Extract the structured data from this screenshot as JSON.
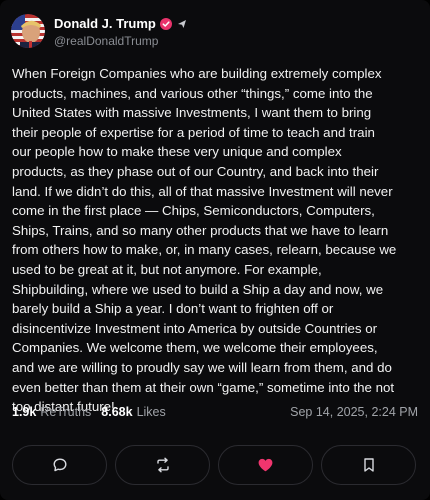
{
  "author": {
    "display_name": "Donald J. Trump",
    "handle": "@realDonaldTrump"
  },
  "post": {
    "lines": [
      "When Foreign Companies who are building extremely complex",
      "products, machines, and various other “things,” come into the",
      "United States with massive Investments, I want them to bring",
      "their people of expertise for a period of time to teach and train",
      "our people how to make these very unique and complex",
      "products, as they phase out of our Country, and back into their",
      "land. If we didn’t do this, all of that massive Investment will never",
      "come in the first place — Chips, Semiconductors, Computers,",
      "Ships, Trains, and so many other products that we have to learn",
      "from others how to make, or, in many cases, relearn, because we",
      "used to be great at it, but not anymore. For example,",
      "Shipbuilding, where we used to build a Ship a day and now, we",
      "barely build a Ship a year. I don’t want to frighten off or",
      "disincentivize Investment into America by outside Countries or",
      "Companies. We welcome them, we welcome their employees,",
      "and we are willing to proudly say we will learn from them, and do",
      "even better than them at their own “game,” sometime into the not",
      "too distant future!"
    ]
  },
  "stats": {
    "retruths_count": "1.9k",
    "retruths_label": "ReTruths",
    "likes_count": "8.68k",
    "likes_label": "Likes",
    "timestamp": "Sep 14, 2025, 2:24 PM"
  },
  "actions": [
    {
      "name": "reply-button",
      "icon": "comment-icon"
    },
    {
      "name": "retruth-button",
      "icon": "repost-icon"
    },
    {
      "name": "like-button",
      "icon": "heart-icon"
    },
    {
      "name": "bookmark-button",
      "icon": "bookmark-icon"
    }
  ],
  "colors": {
    "background": "#0b0b0d",
    "verified_badge": "#e8336b",
    "like_heart": "#f0356e",
    "muted_text": "#a0a3a8"
  }
}
